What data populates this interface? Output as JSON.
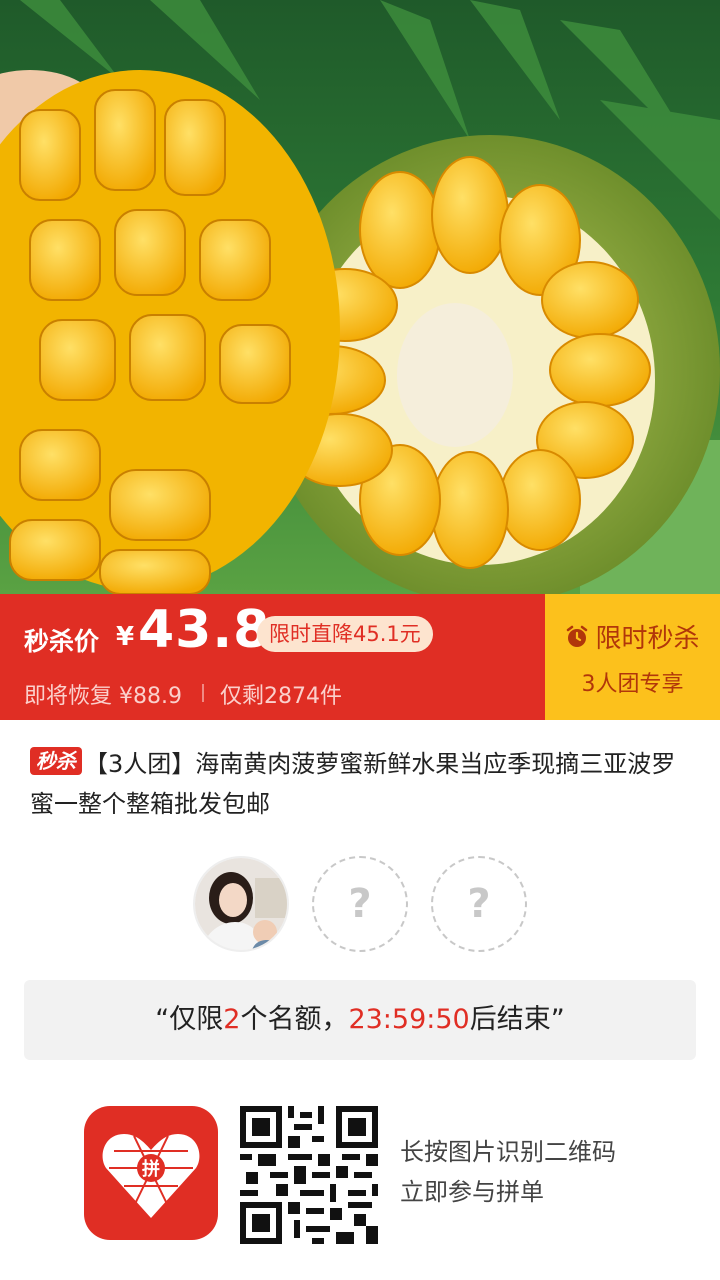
{
  "price_bar": {
    "sale_label": "秒杀价",
    "currency": "¥",
    "price": "43.8",
    "drop_badge": "限时直降45.1元",
    "restore_text": "即将恢复 ¥88.9",
    "remaining_text": "仅剩2874件",
    "flash_title": "限时秒杀",
    "group_only": "3人团专享",
    "colors": {
      "sale_red": "#e02e24",
      "flash_yellow": "#fcc11c"
    }
  },
  "product": {
    "tag": "秒杀",
    "title": "【3人团】海南黄肉菠萝蜜新鲜水果当应季现摘三亚波罗蜜一整个整箱批发包邮"
  },
  "group": {
    "slots": [
      {
        "type": "user-avatar"
      },
      {
        "type": "empty",
        "symbol": "?"
      },
      {
        "type": "empty",
        "symbol": "?"
      }
    ]
  },
  "quota": {
    "prefix": "“仅限",
    "count": "2",
    "middle": "个名额，",
    "countdown": "23:59:50",
    "suffix": "后结束”"
  },
  "share": {
    "line1": "长按图片识别二维码",
    "line2": "立即参与拼单",
    "logo_icon": "pinduoduo-logo-icon",
    "qr_icon": "qr-code-icon"
  }
}
